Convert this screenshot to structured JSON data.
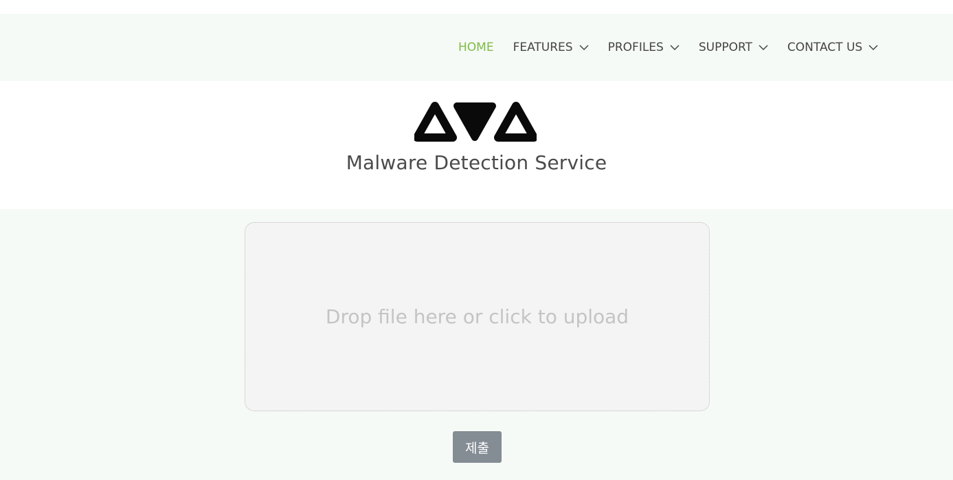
{
  "nav": {
    "items": [
      {
        "label": "HOME",
        "active": true,
        "dropdown": false
      },
      {
        "label": "FEATURES",
        "active": false,
        "dropdown": true
      },
      {
        "label": "PROFILES",
        "active": false,
        "dropdown": true
      },
      {
        "label": "SUPPORT",
        "active": false,
        "dropdown": true
      },
      {
        "label": "CONTACT US",
        "active": false,
        "dropdown": true
      }
    ],
    "active_color": "#7dbb44",
    "dropdown_icon": "chevron-down-icon"
  },
  "brand": {
    "logo_text": "AVA",
    "subtitle": "Malware Detection Service"
  },
  "upload": {
    "dropzone_message": "Drop file here or click to upload",
    "submit_label": "제출"
  },
  "colors": {
    "band_background": "#f6faf6",
    "dropzone_background": "#f4f4f4",
    "button_background": "#848c94"
  }
}
